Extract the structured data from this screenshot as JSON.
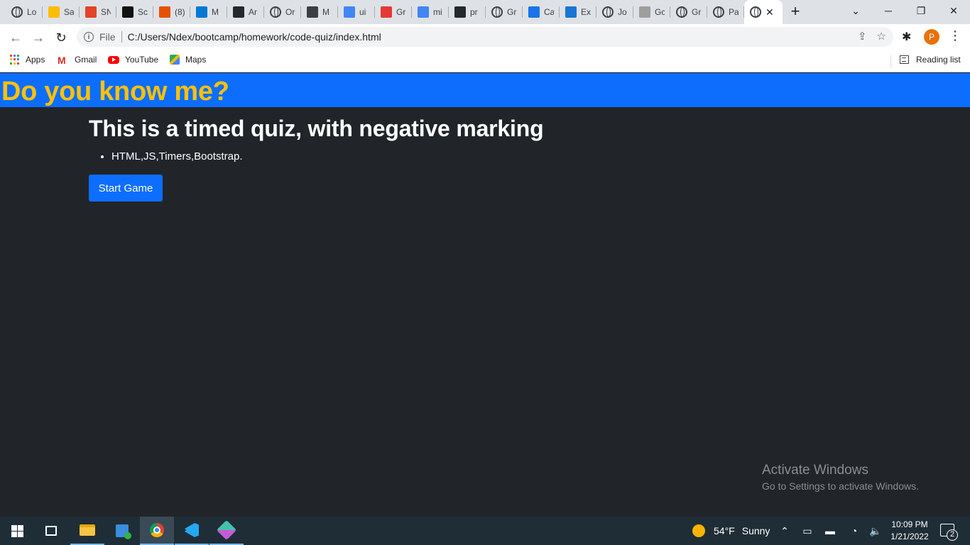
{
  "browser": {
    "tabs": [
      {
        "title": "Lo",
        "icon": "globe-icon"
      },
      {
        "title": "Sa",
        "icon": "google-drive-icon",
        "color": "#fbbc04"
      },
      {
        "title": "SN",
        "icon": "gitlab-icon",
        "color": "#e24329"
      },
      {
        "title": "Sc",
        "icon": "hackerrank-icon",
        "color": "#111111"
      },
      {
        "title": "(8)",
        "icon": "bracket-icon",
        "color": "#e65100"
      },
      {
        "title": "M",
        "icon": "outlook-icon",
        "color": "#0078d4"
      },
      {
        "title": "Ar",
        "icon": "github-icon",
        "color": "#24292e"
      },
      {
        "title": "Or",
        "icon": "globe-icon"
      },
      {
        "title": "M",
        "icon": "document-icon",
        "color": "#3c4043"
      },
      {
        "title": "ui",
        "icon": "link-icon",
        "color": "#4285f4"
      },
      {
        "title": "Gr",
        "icon": "s-letter-icon",
        "color": "#e53935"
      },
      {
        "title": "mi",
        "icon": "google-icon",
        "color": "#4285f4"
      },
      {
        "title": "pr",
        "icon": "github-icon",
        "color": "#24292e"
      },
      {
        "title": "Gr",
        "icon": "world-icon"
      },
      {
        "title": "Ca",
        "icon": "cc-icon",
        "color": "#1a73e8"
      },
      {
        "title": "Ex",
        "icon": "puzzle-icon",
        "color": "#1976d2"
      },
      {
        "title": "Jo",
        "icon": "globe-icon"
      },
      {
        "title": "Gc",
        "icon": "chart-icon",
        "color": "#9e9e9e"
      },
      {
        "title": "Gr",
        "icon": "world-icon"
      },
      {
        "title": "Pa",
        "icon": "globe-icon"
      },
      {
        "title": "",
        "icon": "globe-icon",
        "active": true
      }
    ],
    "url_scheme": "File",
    "url": "C:/Users/Ndex/bootcamp/homework/code-quiz/index.html",
    "profile_initial": "P",
    "bookmarks": [
      {
        "label": "Apps",
        "icon": "apps-grid-icon"
      },
      {
        "label": "Gmail",
        "icon": "gmail-icon"
      },
      {
        "label": "YouTube",
        "icon": "youtube-icon"
      },
      {
        "label": "Maps",
        "icon": "maps-icon"
      }
    ],
    "reading_list": "Reading list"
  },
  "page": {
    "header_title": "Do you know me?",
    "heading": "This is a timed quiz, with negative marking",
    "list_items": [
      "HTML,JS,Timers,Bootstrap."
    ],
    "start_button": "Start Game",
    "header_bg": "#0d6efd",
    "header_text_color": "#ffc107",
    "page_bg": "#212529"
  },
  "watermark": {
    "title": "Activate Windows",
    "subtitle": "Go to Settings to activate Windows."
  },
  "taskbar": {
    "weather_temp": "54°F",
    "weather_condition": "Sunny",
    "time": "10:09 PM",
    "date": "1/21/2022",
    "notification_count": "2"
  }
}
